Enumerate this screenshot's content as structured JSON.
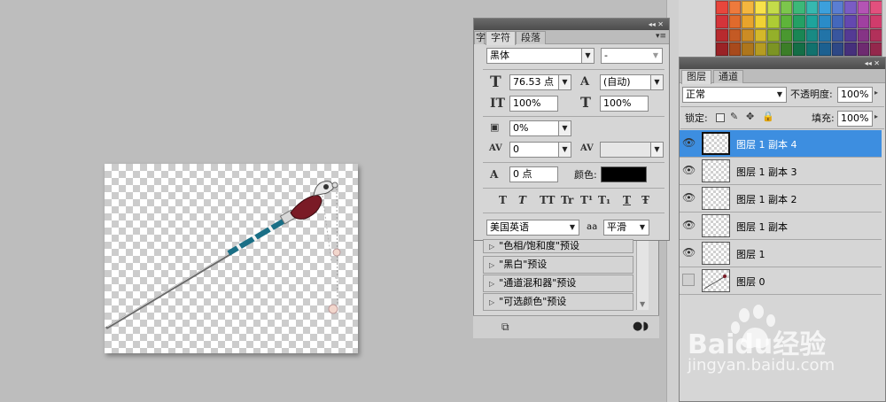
{
  "character_panel": {
    "tabs": [
      "字符",
      "段落"
    ],
    "hidden_tab_partial": "字",
    "font_family": "黑体",
    "font_style": "-",
    "font_size": "76.53 点",
    "leading": "(自动)",
    "vertical_scale": "100%",
    "horizontal_scale": "100%",
    "tsume": "0%",
    "kerning": "0",
    "tracking": "",
    "baseline_shift": "0 点",
    "color_label": "颜色:",
    "color_value": "#000000",
    "language": "美国英语",
    "antialias_label": "aa",
    "antialias": "平滑",
    "type_buttons": [
      "T",
      "T",
      "TT",
      "Tr",
      "T¹",
      "T₁",
      "T",
      "Ŧ"
    ]
  },
  "adjustments_list": {
    "items": [
      "\"色相/饱和度\"预设",
      "\"黑白\"预设",
      "\"通道混和器\"预设",
      "\"可选颜色\"预设"
    ]
  },
  "layers_panel": {
    "tabs": [
      "图层",
      "通道"
    ],
    "blend_mode": "正常",
    "opacity_label": "不透明度:",
    "opacity": "100%",
    "lock_label": "锁定:",
    "fill_label": "填充:",
    "fill": "100%",
    "layers": [
      {
        "name": "图层 1 副本 4",
        "visible": true,
        "selected": true
      },
      {
        "name": "图层 1 副本 3",
        "visible": true,
        "selected": false
      },
      {
        "name": "图层 1 副本 2",
        "visible": true,
        "selected": false
      },
      {
        "name": "图层 1 副本",
        "visible": true,
        "selected": false
      },
      {
        "name": "图层 1",
        "visible": true,
        "selected": false
      },
      {
        "name": "图层 0",
        "visible": false,
        "selected": false
      }
    ]
  },
  "swatch_colors": [
    "#e8463c",
    "#ee7a3c",
    "#f4b63e",
    "#f8e24a",
    "#c4dc4a",
    "#7cc64c",
    "#3cb878",
    "#36b8b0",
    "#3ca0dc",
    "#5a7ed2",
    "#7a5cc4",
    "#b454b4",
    "#e2507e",
    "#d4343a",
    "#e06a2c",
    "#e8a42c",
    "#f0d234",
    "#aecc34",
    "#5eb43a",
    "#24a064",
    "#1ea49c",
    "#2a8cc8",
    "#4468bc",
    "#6448b0",
    "#a040a0",
    "#d03c6c",
    "#b82a2e",
    "#c45a24",
    "#cc8c24",
    "#d4b82a",
    "#94b02a",
    "#4a9830",
    "#1a8654",
    "#188a84",
    "#2274a8",
    "#38569e",
    "#543a94",
    "#863486",
    "#b2305a",
    "#9a2226",
    "#a84a1c",
    "#ae761c",
    "#b69c22",
    "#7c9424",
    "#3c7e28",
    "#146e46",
    "#12726e",
    "#1c6090",
    "#2e4886",
    "#46307c",
    "#6e2a70",
    "#94284c"
  ],
  "watermark": {
    "brand": "Baidu经验",
    "url": "jingyan.baidu.com"
  }
}
